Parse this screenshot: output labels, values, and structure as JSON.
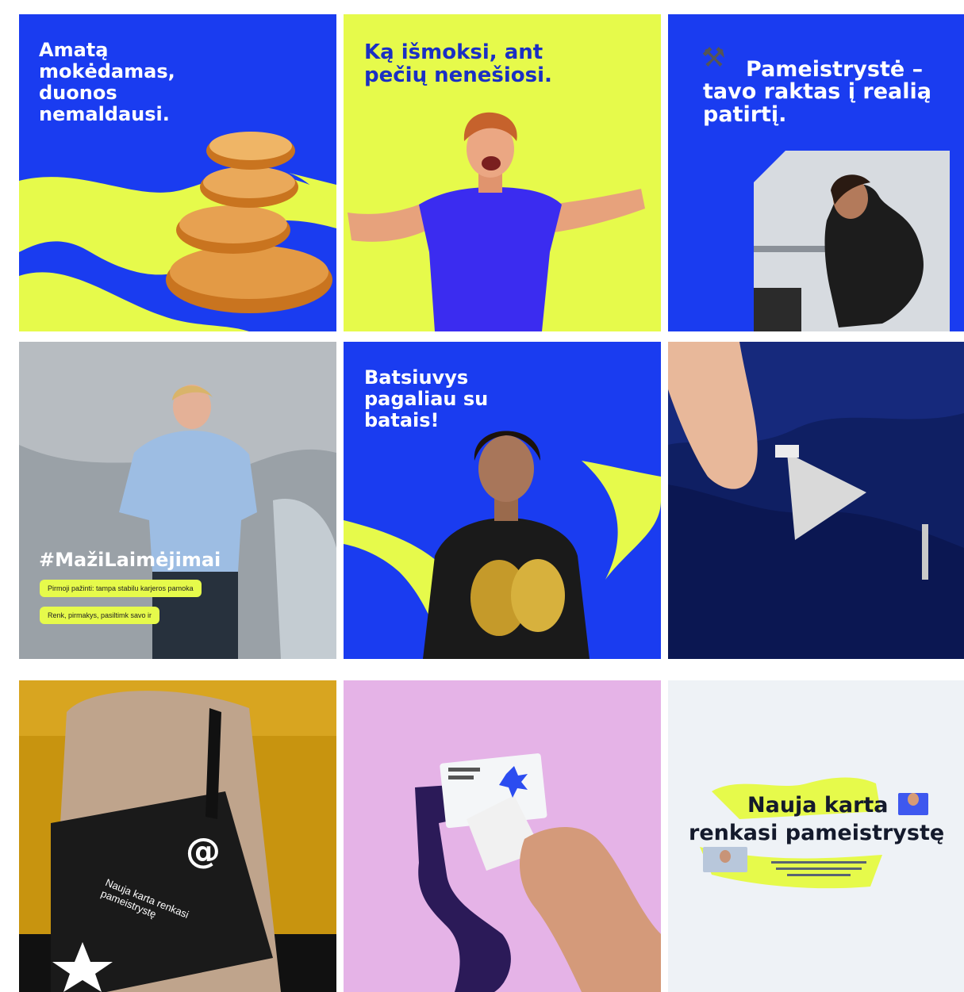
{
  "tiles": {
    "t1": {
      "headline": "Amatą mokėdamas, duonos nemaldausi."
    },
    "t2": {
      "headline": "Ką išmoksi, ant pečių nenešiosi."
    },
    "t3": {
      "emoji": "⚒",
      "headline": "Pameistrystė – tavo raktas į realią patirtį."
    },
    "t4": {
      "hashtag": "#MažiLaimėjimai",
      "pill1": "Pirmoji pažinti: tampa stabilu karjeros pamoka",
      "pill2": "Renk, pirmakys, pasiltimk savo ir"
    },
    "t5": {
      "headline": "Batsiuvys pagaliau su batais!"
    },
    "t6": {},
    "t7": {
      "bag_text": "Nauja karta renkasi pameistrystę"
    },
    "t8": {},
    "t9": {
      "line1": "Nauja karta",
      "line2": "renkasi pameistrystę"
    }
  },
  "colors": {
    "blue": "#1a3cf0",
    "lime": "#e6fa4b",
    "lilac": "#e5b3e7"
  }
}
